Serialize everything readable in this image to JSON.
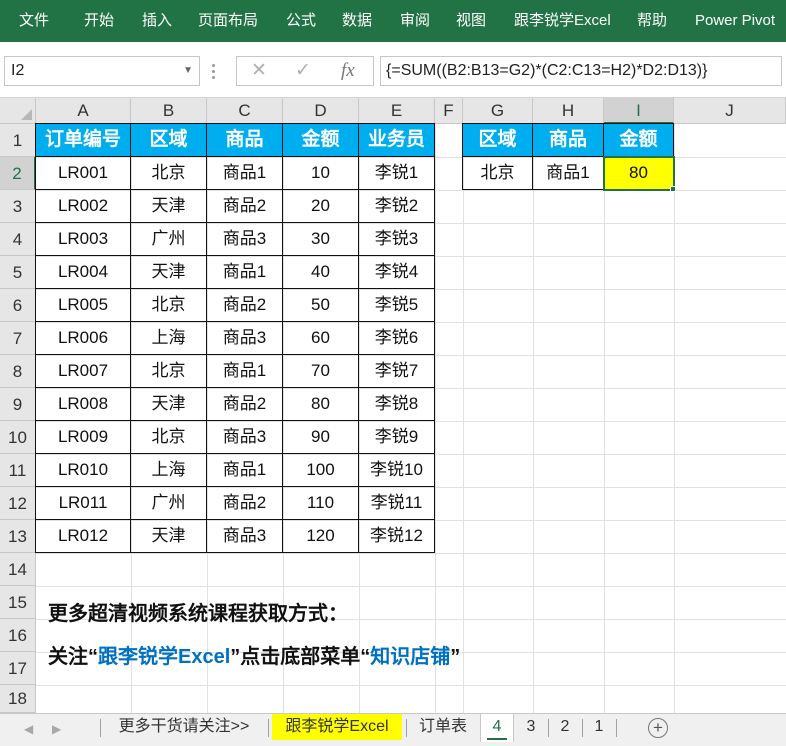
{
  "ribbon": {
    "tabs": [
      "文件",
      "开始",
      "插入",
      "页面布局",
      "公式",
      "数据",
      "审阅",
      "视图",
      "跟李锐学Excel",
      "帮助",
      "Power Pivot"
    ]
  },
  "formula_bar": {
    "name_box": "I2",
    "cancel_icon": "✕",
    "enter_icon": "✓",
    "function_icon": "fx",
    "formula": "{=SUM((B2:B13=G2)*(C2:C13=H2)*D2:D13)}"
  },
  "columns": [
    "A",
    "B",
    "C",
    "D",
    "E",
    "F",
    "G",
    "H",
    "I",
    "J"
  ],
  "selected_column": "I",
  "rows": [
    "1",
    "2",
    "3",
    "4",
    "5",
    "6",
    "7",
    "8",
    "9",
    "10",
    "11",
    "12",
    "13",
    "14",
    "15",
    "16",
    "17",
    "18"
  ],
  "selected_row": "2",
  "order_table": {
    "headers": [
      "订单编号",
      "区域",
      "商品",
      "金额",
      "业务员"
    ],
    "rows": [
      [
        "LR001",
        "北京",
        "商品1",
        "10",
        "李锐1"
      ],
      [
        "LR002",
        "天津",
        "商品2",
        "20",
        "李锐2"
      ],
      [
        "LR003",
        "广州",
        "商品3",
        "30",
        "李锐3"
      ],
      [
        "LR004",
        "天津",
        "商品1",
        "40",
        "李锐4"
      ],
      [
        "LR005",
        "北京",
        "商品2",
        "50",
        "李锐5"
      ],
      [
        "LR006",
        "上海",
        "商品3",
        "60",
        "李锐6"
      ],
      [
        "LR007",
        "北京",
        "商品1",
        "70",
        "李锐7"
      ],
      [
        "LR008",
        "天津",
        "商品2",
        "80",
        "李锐8"
      ],
      [
        "LR009",
        "北京",
        "商品3",
        "90",
        "李锐9"
      ],
      [
        "LR010",
        "上海",
        "商品1",
        "100",
        "李锐10"
      ],
      [
        "LR011",
        "广州",
        "商品2",
        "110",
        "李锐11"
      ],
      [
        "LR012",
        "天津",
        "商品3",
        "120",
        "李锐12"
      ]
    ]
  },
  "lookup_table": {
    "headers": [
      "区域",
      "商品",
      "金额"
    ],
    "values": [
      "北京",
      "商品1",
      "80"
    ]
  },
  "notes": {
    "line1": "更多超清视频系统课程获取方式：",
    "line2_prefix": "关注“",
    "line2_link1": "跟李锐学Excel",
    "line2_mid": "”点击底部菜单“",
    "line2_link2": "知识店铺",
    "line2_suffix": "”"
  },
  "sheet_tabs": {
    "prev_icon": "◀",
    "next_icon": "▶",
    "tabs": [
      "更多干货请关注>>",
      "跟李锐学Excel",
      "订单表",
      "4",
      "3",
      "2",
      "1"
    ],
    "active": "4",
    "add_icon": "+"
  },
  "colors": {
    "ribbon": "#217346",
    "header_fill": "#00aeef",
    "highlight": "#ffff00",
    "note_link": "#0070c0"
  }
}
